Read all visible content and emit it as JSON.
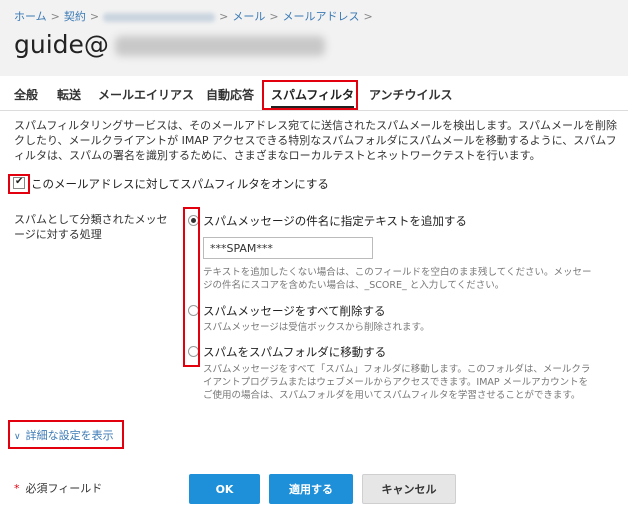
{
  "breadcrumb": {
    "home": "ホーム",
    "contract": "契約",
    "mail": "メール",
    "mail_address": "メールアドレス"
  },
  "page": {
    "title": "guide@"
  },
  "tabs": [
    {
      "label": "全般"
    },
    {
      "label": "転送"
    },
    {
      "label": "メールエイリアス"
    },
    {
      "label": "自動応答"
    },
    {
      "label": "スパムフィルタ"
    },
    {
      "label": "アンチウイルス"
    }
  ],
  "description": {
    "line1": "スパムフィルタリングサービスは、そのメールアドレス宛てに送信されたスパムメールを検出します。スパムメールを削除",
    "line2": "クしたり、メールクライアントが IMAP アクセスできる特別なスパムフォルダにスパムメールを移動するように、スパムフ",
    "line3": "ィルタは、スパムの署名を識別するために、さまざまなローカルテストとネットワークテストを行います。"
  },
  "enable_checkbox": {
    "label": "このメールアドレスに対してスパムフィルタをオンにする",
    "checked": true
  },
  "spam_action": {
    "label_line1": "スパムとして分類されたメッセ",
    "label_line2": "ージに対する処理",
    "selected": "add_text",
    "options": {
      "add_text": {
        "label": "スパムメッセージの件名に指定テキストを追加する",
        "input_value": "***SPAM***",
        "hint1": "テキストを追加したくない場合は、このフィールドを空白のまま残してください。メッセー",
        "hint2": "ジの件名にスコアを含めたい場合は、_SCORE_ と入力してください。"
      },
      "delete": {
        "label": "スパムメッセージをすべて削除する",
        "hint1": "スパムメッセージは受信ボックスから削除されます。"
      },
      "move": {
        "label": "スパムをスパムフォルダに移動する",
        "hint1": "スパムメッセージをすべて「スパム」フォルダに移動します。このフォルダは、メールクラ",
        "hint2": "イアントプログラムまたはウェブメールからアクセスできます。IMAP メールアカウントを",
        "hint3": "ご使用の場合は、スパムフォルダを用いてスパムフィルタを学習させることができます。"
      }
    }
  },
  "advanced": {
    "label": "詳細な設定を表示"
  },
  "footer": {
    "required_label": "必須フィールド",
    "ok_label": "OK",
    "apply_label": "適用する",
    "cancel_label": "キャンセル"
  },
  "colors": {
    "highlight": "#e2000f",
    "link": "#3b7ab5",
    "primary_button": "#1e90d9"
  }
}
